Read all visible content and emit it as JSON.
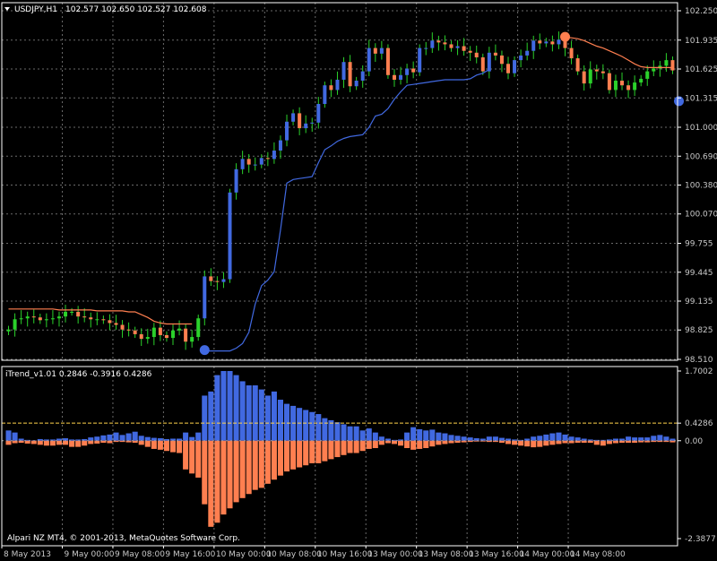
{
  "chart_data": [
    {
      "type": "candlestick",
      "title": "USDJPY,H1",
      "ohlc_text": "102.577 102.650 102.527 102.608",
      "ylim": [
        98.51,
        102.25
      ],
      "y_ticks": [
        "102.250",
        "101.935",
        "101.625",
        "101.315",
        "101.000",
        "100.690",
        "100.380",
        "100.070",
        "99.755",
        "99.445",
        "99.135",
        "98.825",
        "98.510"
      ],
      "x_ticks": [
        "8 May 2013",
        "9 May 00:00",
        "9 May 08:00",
        "9 May 16:00",
        "10 May 00:00",
        "10 May 08:00",
        "10 May 16:00",
        "13 May 00:00",
        "13 May 08:00",
        "13 May 16:00",
        "14 May 00:00",
        "14 May 08:00"
      ],
      "grid": true,
      "colors": {
        "bull": "#2bd12b",
        "bear": "#ff7f50",
        "bull_body": "#4169e1",
        "trend_up": "#4169e1",
        "trend_down": "#ff7f50"
      },
      "closes": [
        98.83,
        98.94,
        98.95,
        98.97,
        98.96,
        98.93,
        98.94,
        98.95,
        98.97,
        99.02,
        99.02,
        98.97,
        98.96,
        98.94,
        98.94,
        98.93,
        98.9,
        98.88,
        98.83,
        98.82,
        98.78,
        98.73,
        98.75,
        98.85,
        98.77,
        98.74,
        98.82,
        98.84,
        98.7,
        98.75,
        98.95,
        99.4,
        99.35,
        99.34,
        99.37,
        100.3,
        100.55,
        100.66,
        100.6,
        100.6,
        100.67,
        100.66,
        100.75,
        100.86,
        101.06,
        101.15,
        100.99,
        101.04,
        101.05,
        101.25,
        101.45,
        101.4,
        101.51,
        101.7,
        101.44,
        101.5,
        101.6,
        101.85,
        101.79,
        101.85,
        101.56,
        101.51,
        101.56,
        101.63,
        101.59,
        101.85,
        101.85,
        101.93,
        101.91,
        101.89,
        101.85,
        101.87,
        101.82,
        101.8,
        101.75,
        101.6,
        101.8,
        101.77,
        101.68,
        101.58,
        101.72,
        101.77,
        101.82,
        101.93,
        101.9,
        101.92,
        101.89,
        101.94,
        101.85,
        101.74,
        101.6,
        101.47,
        101.62,
        101.6,
        101.58,
        101.4,
        101.5,
        101.45,
        101.4,
        101.48,
        101.52,
        101.6,
        101.63,
        101.66,
        101.72,
        101.61
      ],
      "trend_up": [
        {
          "from": 31,
          "to": 77,
          "values": [
            98.6,
            98.6,
            98.6,
            98.6,
            98.6,
            98.63,
            98.68,
            98.8,
            99.1,
            99.3,
            99.36,
            99.45,
            99.9,
            100.4,
            100.44,
            100.45,
            100.46,
            100.47,
            100.62,
            100.76,
            100.8,
            100.85,
            100.88,
            100.9,
            100.91,
            100.92,
            101.0,
            101.12,
            101.14,
            101.2,
            101.3,
            101.38,
            101.45,
            101.46,
            101.47,
            101.48,
            101.49,
            101.5,
            101.51,
            101.51,
            101.51,
            101.51,
            101.52,
            101.56,
            101.58,
            101.62
          ]
        }
      ],
      "trend_down": [
        {
          "from": 0,
          "to": 30,
          "values": [
            99.05,
            99.05,
            99.05,
            99.05,
            99.05,
            99.05,
            99.05,
            99.05,
            99.04,
            99.04,
            99.04,
            99.04,
            99.04,
            99.04,
            99.03,
            99.03,
            99.03,
            99.03,
            99.03,
            99.02,
            99.02,
            98.99,
            98.96,
            98.92,
            98.9,
            98.89,
            98.89,
            98.89,
            98.89,
            98.89
          ]
        },
        {
          "from": 88,
          "to": 106,
          "values": [
            101.97,
            101.96,
            101.95,
            101.93,
            101.9,
            101.87,
            101.85,
            101.82,
            101.79,
            101.76,
            101.72,
            101.68,
            101.65,
            101.64,
            101.64,
            101.64,
            101.64,
            101.64
          ]
        }
      ],
      "markers": [
        {
          "index": 31,
          "value": 98.61,
          "color": "#4169e1"
        },
        {
          "index": 88,
          "value": 101.97,
          "color": "#ff7f50"
        },
        {
          "index": 106,
          "value": 101.28,
          "color": "#4169e1"
        }
      ]
    },
    {
      "type": "bar",
      "title": "iTrend_v1.01 0.2846 -0.3916 0.4286",
      "ylim": [
        -2.3877,
        1.7002
      ],
      "y_ticks": [
        "1.7002",
        "0.4286",
        "0.00",
        "-2.3877"
      ],
      "level": 0.4286,
      "series": [
        {
          "name": "positive",
          "color": "#4169e1",
          "values": [
            0.25,
            0.2,
            0.05,
            0.02,
            0.01,
            0.04,
            0.03,
            0.03,
            0.05,
            0.06,
            0.03,
            0.03,
            0.04,
            0.08,
            0.1,
            0.13,
            0.15,
            0.2,
            0.14,
            0.18,
            0.22,
            0.12,
            0.09,
            0.07,
            0.06,
            0.04,
            0.05,
            0.05,
            0.2,
            0.09,
            0.2,
            1.1,
            1.2,
            1.6,
            1.7,
            1.7,
            1.6,
            1.45,
            1.35,
            1.35,
            1.25,
            1.1,
            1.2,
            1.0,
            0.9,
            0.85,
            0.8,
            0.75,
            0.7,
            0.65,
            0.55,
            0.5,
            0.45,
            0.4,
            0.35,
            0.35,
            0.25,
            0.3,
            0.2,
            0.1,
            0.05,
            0.02,
            0.03,
            0.2,
            0.33,
            0.28,
            0.25,
            0.27,
            0.2,
            0.18,
            0.14,
            0.12,
            0.1,
            0.08,
            0.06,
            0.05,
            0.1,
            0.1,
            0.07,
            0.05,
            0.03,
            0.02,
            0.05,
            0.1,
            0.12,
            0.15,
            0.18,
            0.2,
            0.15,
            0.1,
            0.08,
            0.05,
            0.03,
            0.02,
            0.02,
            0.03,
            0.05,
            0.05,
            0.1,
            0.08,
            0.08,
            0.08,
            0.12,
            0.14,
            0.1,
            0.05
          ]
        },
        {
          "name": "negative",
          "color": "#ff7f50",
          "values": [
            -0.1,
            -0.06,
            -0.05,
            -0.07,
            -0.08,
            -0.1,
            -0.12,
            -0.12,
            -0.1,
            -0.1,
            -0.15,
            -0.15,
            -0.12,
            -0.08,
            -0.07,
            -0.05,
            -0.06,
            -0.03,
            -0.03,
            -0.04,
            -0.05,
            -0.1,
            -0.15,
            -0.2,
            -0.22,
            -0.25,
            -0.28,
            -0.3,
            -0.7,
            -0.8,
            -0.9,
            -1.55,
            -2.1,
            -2.0,
            -1.8,
            -1.65,
            -1.5,
            -1.4,
            -1.3,
            -1.2,
            -1.15,
            -1.05,
            -0.95,
            -0.85,
            -0.75,
            -0.7,
            -0.65,
            -0.6,
            -0.55,
            -0.55,
            -0.5,
            -0.45,
            -0.4,
            -0.35,
            -0.3,
            -0.3,
            -0.25,
            -0.2,
            -0.18,
            -0.1,
            -0.06,
            -0.08,
            -0.12,
            -0.18,
            -0.22,
            -0.2,
            -0.18,
            -0.14,
            -0.1,
            -0.08,
            -0.06,
            -0.05,
            -0.04,
            -0.03,
            -0.02,
            -0.02,
            -0.03,
            -0.03,
            -0.05,
            -0.08,
            -0.1,
            -0.12,
            -0.14,
            -0.16,
            -0.15,
            -0.12,
            -0.1,
            -0.08,
            -0.06,
            -0.06,
            -0.05,
            -0.05,
            -0.05,
            -0.1,
            -0.12,
            -0.08,
            -0.06,
            -0.05,
            -0.05,
            -0.05,
            -0.04,
            -0.04,
            -0.03,
            -0.03,
            -0.03,
            -0.04
          ]
        }
      ]
    }
  ],
  "footer": {
    "copyright": "Alpari NZ MT4, © 2001-2013, MetaQuotes Software Corp."
  }
}
